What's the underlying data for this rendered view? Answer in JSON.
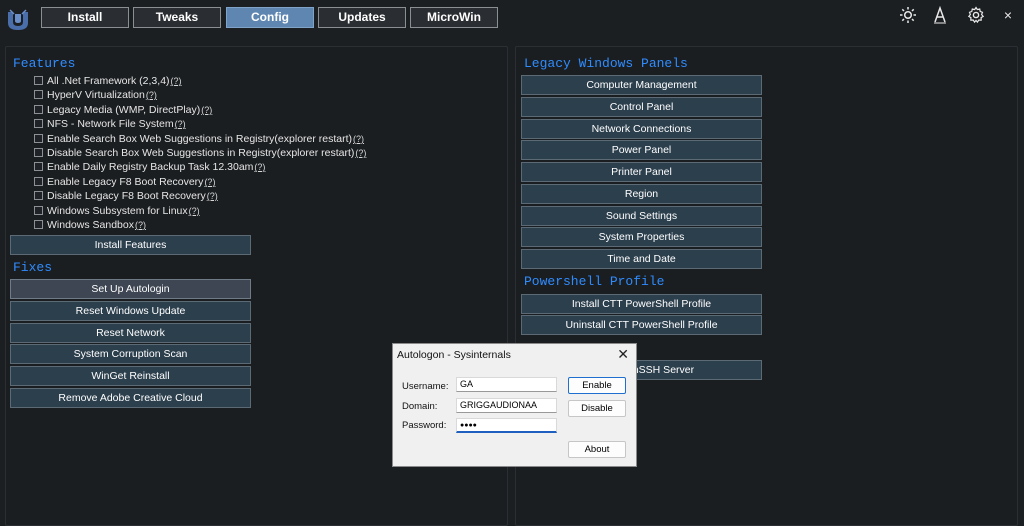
{
  "nav": {
    "tabs": [
      {
        "label": "Install",
        "active": false
      },
      {
        "label": "Tweaks",
        "active": false
      },
      {
        "label": "Config",
        "active": true
      },
      {
        "label": "Updates",
        "active": false
      },
      {
        "label": "MicroWin",
        "active": false
      }
    ],
    "icons": [
      "theme-toggle-icon",
      "font-scaling-icon",
      "settings-gear-icon",
      "close-icon"
    ],
    "close_glyph": "×"
  },
  "features": {
    "title": "Features",
    "items": [
      {
        "label": "All .Net Framework (2,3,4)",
        "help": "(?)",
        "checked": false
      },
      {
        "label": "HyperV Virtualization",
        "help": "(?)",
        "checked": false
      },
      {
        "label": "Legacy Media (WMP, DirectPlay)",
        "help": "(?)",
        "checked": false
      },
      {
        "label": "NFS - Network File System",
        "help": "(?)",
        "checked": false
      },
      {
        "label": "Enable Search Box Web Suggestions in Registry(explorer restart)",
        "help": "(?)",
        "checked": false
      },
      {
        "label": "Disable Search Box Web Suggestions in Registry(explorer restart)",
        "help": "(?)",
        "checked": false
      },
      {
        "label": "Enable Daily Registry Backup Task 12.30am",
        "help": "(?)",
        "checked": false
      },
      {
        "label": "Enable Legacy F8 Boot Recovery",
        "help": "(?)",
        "checked": false
      },
      {
        "label": "Disable Legacy F8 Boot Recovery",
        "help": "(?)",
        "checked": false
      },
      {
        "label": "Windows Subsystem for Linux",
        "help": "(?)",
        "checked": false
      },
      {
        "label": "Windows Sandbox",
        "help": "(?)",
        "checked": false
      }
    ],
    "install_button": "Install Features"
  },
  "fixes": {
    "title": "Fixes",
    "buttons": [
      "Set Up Autologin",
      "Reset Windows Update",
      "Reset Network",
      "System Corruption Scan",
      "WinGet Reinstall",
      "Remove Adobe Creative Cloud"
    ]
  },
  "legacy_panels": {
    "title": "Legacy Windows Panels",
    "buttons": [
      "Computer Management",
      "Control Panel",
      "Network Connections",
      "Power Panel",
      "Printer Panel",
      "Region",
      "Sound Settings",
      "System Properties",
      "Time and Date"
    ]
  },
  "powershell_profile": {
    "title": "Powershell Profile",
    "buttons": [
      "Install CTT PowerShell Profile",
      "Uninstall CTT PowerShell Profile"
    ],
    "partial_button": "enSSH Server"
  },
  "dialog": {
    "title": "Autologon - Sysinternals",
    "close_glyph": "✕",
    "username_label": "Username:",
    "username_value": "GA",
    "domain_label": "Domain:",
    "domain_value": "GRIGGAUDIONAA",
    "password_label": "Password:",
    "password_value": "●●●●",
    "enable_button": "Enable",
    "disable_button": "Disable",
    "about_button": "About"
  },
  "colors": {
    "background": "#1c1f22",
    "section_title": "#2f8cff",
    "button_bg": "#2c3f4d",
    "active_tab": "#5f86b0"
  }
}
